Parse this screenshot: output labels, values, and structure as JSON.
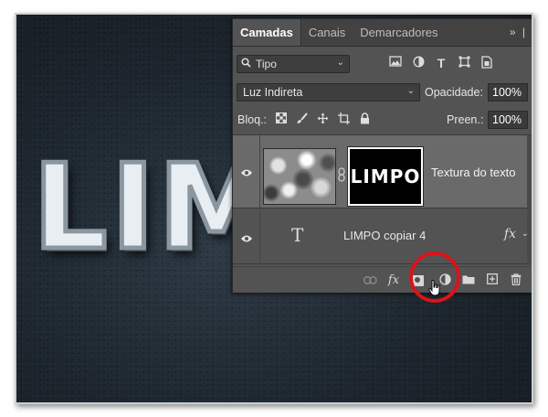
{
  "canvas": {
    "text": "LIMPO"
  },
  "panel": {
    "tabs": [
      {
        "label": "Camadas",
        "active": true
      },
      {
        "label": "Canais",
        "active": false
      },
      {
        "label": "Demarcadores",
        "active": false
      }
    ],
    "tab_tools": "»  |",
    "filter": {
      "value": "Tipo"
    },
    "blend_mode": {
      "value": "Luz Indireta"
    },
    "opacity": {
      "label": "Opacidade:",
      "value": "100%"
    },
    "lock": {
      "label": "Bloq.:"
    },
    "fill": {
      "label": "Preen.:",
      "value": "100%"
    },
    "layers": [
      {
        "name": "Textura do texto",
        "mask_text": "LIMPO",
        "selected": true
      },
      {
        "name": "LIMPO copiar 4",
        "fx": "fx",
        "selected": false
      }
    ]
  },
  "colors": {
    "highlight": "#d8141c",
    "panel_bg": "#535353",
    "selected_layer": "#6a6a6a"
  },
  "icons": {
    "filter": [
      "image-filter-icon",
      "adjustment-filter-icon",
      "type-filter-icon",
      "shape-filter-icon",
      "smart-object-filter-icon"
    ],
    "lock": [
      "lock-transparent-icon",
      "lock-brush-icon",
      "lock-position-icon",
      "lock-artboard-icon",
      "lock-all-icon"
    ],
    "bottom": [
      "link-layers-icon",
      "add-style-icon",
      "add-mask-icon",
      "adjustment-layer-icon",
      "new-group-icon",
      "new-layer-icon",
      "delete-layer-icon"
    ]
  }
}
